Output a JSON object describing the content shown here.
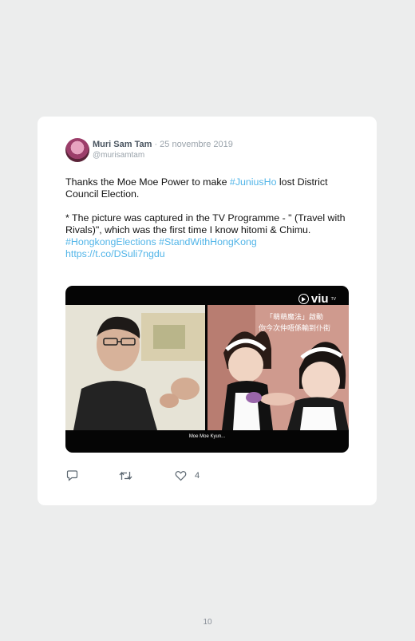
{
  "tweet": {
    "author_name": "Muri Sam Tam",
    "separator": "·",
    "date": "25 novembre 2019",
    "handle": "@murisamtam",
    "text_1": "Thanks the Moe Moe Power to make ",
    "hashtag_1": "#JuniusHo",
    "text_2": " lost District Council Election.",
    "text_3": "* The picture was captured in the TV Programme - \" (Travel with Rivals)\", which was the first time I know hitomi & Chimu.",
    "hashtag_2": "#HongkongElections",
    "hashtag_3": "#StandWithHongKong",
    "link": "https://t.co/DSuli7ngdu",
    "like_count": "4"
  },
  "media": {
    "logo_text": "viu",
    "logo_tm": "TV",
    "caption_line_1": "「萌萌魔法」啟動",
    "caption_line_2": "你今次仲唔係輸到仆街",
    "subtitle": "Moe Moe Kyun..."
  },
  "page_number": "10",
  "colors": {
    "link": "#52b5e8",
    "background": "#eceded"
  }
}
